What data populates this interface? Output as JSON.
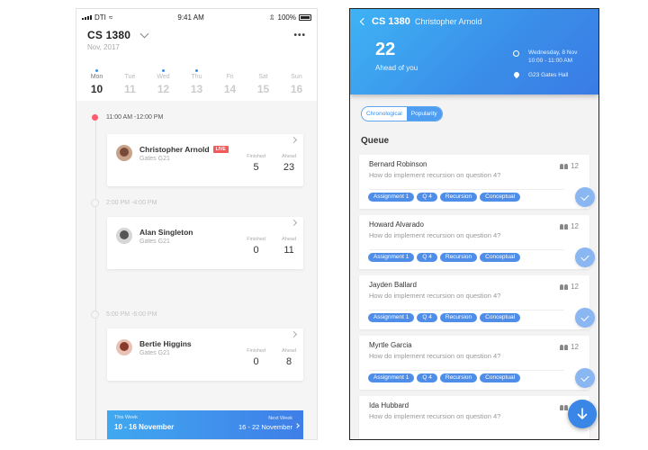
{
  "left": {
    "status": {
      "carrier": "DTI",
      "time": "9:41 AM",
      "battery": "100%"
    },
    "header": {
      "title": "CS 1380",
      "subtitle": "Nov, 2017",
      "more": "•••"
    },
    "days": [
      {
        "name": "Mon",
        "num": "10",
        "active": true,
        "dot": true
      },
      {
        "name": "Tue",
        "num": "11",
        "active": false,
        "dot": false
      },
      {
        "name": "Wed",
        "num": "12",
        "active": false,
        "dot": true
      },
      {
        "name": "Thu",
        "num": "13",
        "active": false,
        "dot": true
      },
      {
        "name": "Fri",
        "num": "14",
        "active": false,
        "dot": false
      },
      {
        "name": "Sat",
        "num": "15",
        "active": false,
        "dot": false
      },
      {
        "name": "Sun",
        "num": "16",
        "active": false,
        "dot": false
      }
    ],
    "slots": [
      {
        "time": "11:00 AM -12:00 PM",
        "name": "Christopher Arnold",
        "live": "LIVE",
        "loc": "Gates G21",
        "finished_label": "Finished",
        "finished": "5",
        "ahead_label": "Ahead",
        "ahead": "23"
      },
      {
        "time": "2:00 PM -4:00 PM",
        "name": "Alan Singleton",
        "live": "",
        "loc": "Gates G21",
        "finished_label": "Finished",
        "finished": "0",
        "ahead_label": "Ahead",
        "ahead": "11"
      },
      {
        "time": "5:00 PM -6:00 PM",
        "name": "Bertie Higgins",
        "live": "",
        "loc": "Gates G21",
        "finished_label": "Finished",
        "finished": "0",
        "ahead_label": "Ahead",
        "ahead": "8"
      }
    ],
    "week": {
      "this_label": "This Week",
      "this_value": "10 - 16 November",
      "next_label": "Next Week",
      "next_value": "16 - 22 November"
    }
  },
  "right": {
    "header": {
      "course": "CS 1380",
      "ta": "Christopher Arnold",
      "ahead_count": "22",
      "ahead_label": "Ahead of you",
      "date": "Wednesday, 8 Nov",
      "time": "10:00 - 11:00 AM",
      "location": "G23 Gates Hall"
    },
    "segments": [
      "Chronological",
      "Popularity"
    ],
    "queue_title": "Queue",
    "queue": [
      {
        "name": "Bernard Robinson",
        "question": "How do implement recursion on question 4?",
        "count": "12",
        "tags": [
          "Assignment 1",
          "Q 4",
          "Recursion",
          "Conceptual"
        ]
      },
      {
        "name": "Howard Alvarado",
        "question": "How do implement recursion on question 4?",
        "count": "12",
        "tags": [
          "Assignment 1",
          "Q 4",
          "Recursion",
          "Conceptual"
        ]
      },
      {
        "name": "Jayden Ballard",
        "question": "How do implement recursion on question 4?",
        "count": "12",
        "tags": [
          "Assignment 1",
          "Q 4",
          "Recursion",
          "Conceptual"
        ]
      },
      {
        "name": "Myrtle Garcia",
        "question": "How do implement recursion on question 4?",
        "count": "12",
        "tags": [
          "Assignment 1",
          "Q 4",
          "Recursion",
          "Conceptual"
        ]
      },
      {
        "name": "Ida Hubbard",
        "question": "How do implement recursion on question 4?",
        "count": "12",
        "tags": []
      }
    ],
    "colors": {
      "accent": "#3a8ee6",
      "live": "#f25a5a"
    }
  }
}
